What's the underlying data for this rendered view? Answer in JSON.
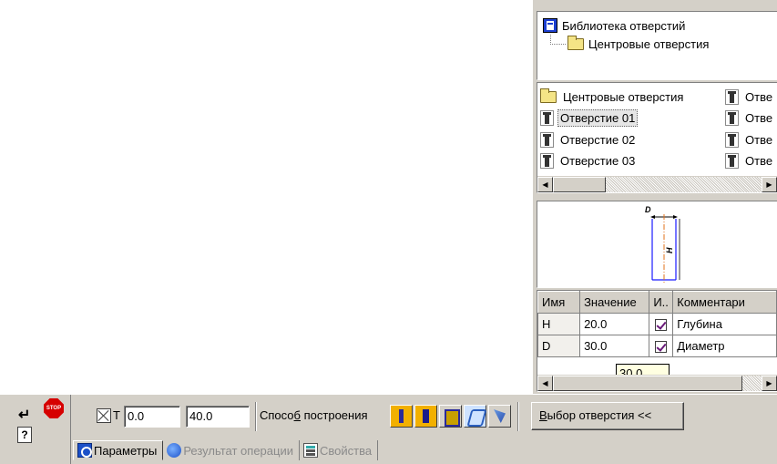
{
  "tree": {
    "root": "Библиотека отверстий",
    "child": "Центровые отверстия"
  },
  "file_list": {
    "col1": [
      {
        "icon": "folder-icon",
        "label": "Центровые отверстия"
      },
      {
        "icon": "hole-icon",
        "label": "Отверстие 01",
        "selected": true
      },
      {
        "icon": "hole-icon",
        "label": "Отверстие 02"
      },
      {
        "icon": "hole-icon",
        "label": "Отверстие 03"
      }
    ],
    "col2": [
      {
        "icon": "hole-icon",
        "label": "Отве"
      },
      {
        "icon": "hole-icon",
        "label": "Отве"
      },
      {
        "icon": "hole-icon",
        "label": "Отве"
      },
      {
        "icon": "hole-icon",
        "label": "Отве"
      }
    ]
  },
  "preview": {
    "dim_top": "D",
    "dim_side": "H"
  },
  "params_table": {
    "headers": [
      "Имя",
      "Значение",
      "И..",
      "Комментари"
    ],
    "rows": [
      {
        "name": "H",
        "value": "20.0",
        "checked": true,
        "comment": "Глубина"
      },
      {
        "name": "D",
        "value": "30.0",
        "checked": true,
        "comment": "Диаметр"
      }
    ],
    "tooltip": "30.0"
  },
  "toolbar": {
    "t_label": "T",
    "field_x": "0.0",
    "field_y": "40.0",
    "method_label_prefix": "Спосо",
    "method_label_underlined": "б",
    "method_label_suffix": " построения",
    "choice_prefix": "",
    "choice_underlined": "В",
    "choice_suffix": "ыбор отверстия  <<"
  },
  "left_controls": {
    "stop_text": "STOP",
    "help_text": "?",
    "enter_glyph": "↵"
  },
  "tabs": [
    {
      "label": "Параметры",
      "active": true
    },
    {
      "label": "Результат операции",
      "active": false
    },
    {
      "label": "Свойства",
      "active": false
    }
  ],
  "colors": {
    "panel_bg": "#d4d0c8",
    "hole_line": "#1a1aff",
    "axis_line": "#e0701a"
  }
}
